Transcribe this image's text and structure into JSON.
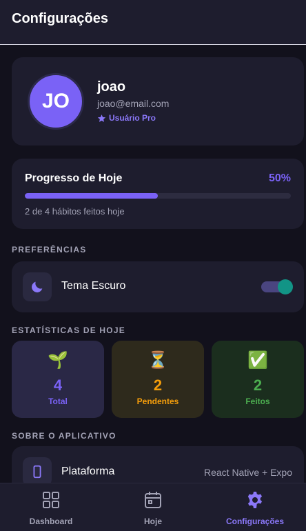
{
  "header": {
    "title": "Configurações"
  },
  "profile": {
    "initials": "JO",
    "name": "joao",
    "email": "joao@email.com",
    "badge": "Usuário Pro"
  },
  "progress": {
    "title": "Progresso de Hoje",
    "percent_label": "50%",
    "fraction": 0.5,
    "caption": "2 de 4 hábitos feitos hoje"
  },
  "sections": {
    "preferences": "PREFERÊNCIAS",
    "stats": "ESTATÍSTICAS DE HOJE",
    "about": "SOBRE O APLICATIVO"
  },
  "preferences": {
    "dark_theme_label": "Tema Escuro",
    "dark_theme_on": true
  },
  "stats": [
    {
      "emoji": "🌱",
      "value": "4",
      "label": "Total",
      "color": "#7a62f6",
      "bg": "#2a2846"
    },
    {
      "emoji": "⏳",
      "value": "2",
      "label": "Pendentes",
      "color": "#f59e0b",
      "bg": "#2e2a1c"
    },
    {
      "emoji": "✅",
      "value": "2",
      "label": "Feitos",
      "color": "#4caf50",
      "bg": "#1b2e1e"
    }
  ],
  "about": {
    "platform_label": "Plataforma",
    "platform_value": "React Native + Expo"
  },
  "tabs": [
    {
      "label": "Dashboard",
      "icon": "grid-icon"
    },
    {
      "label": "Hoje",
      "icon": "calendar-icon"
    },
    {
      "label": "Configurações",
      "icon": "gear-icon",
      "active": true
    }
  ],
  "colors": {
    "accent": "#7a62f6",
    "toggle_on": "#129486"
  }
}
